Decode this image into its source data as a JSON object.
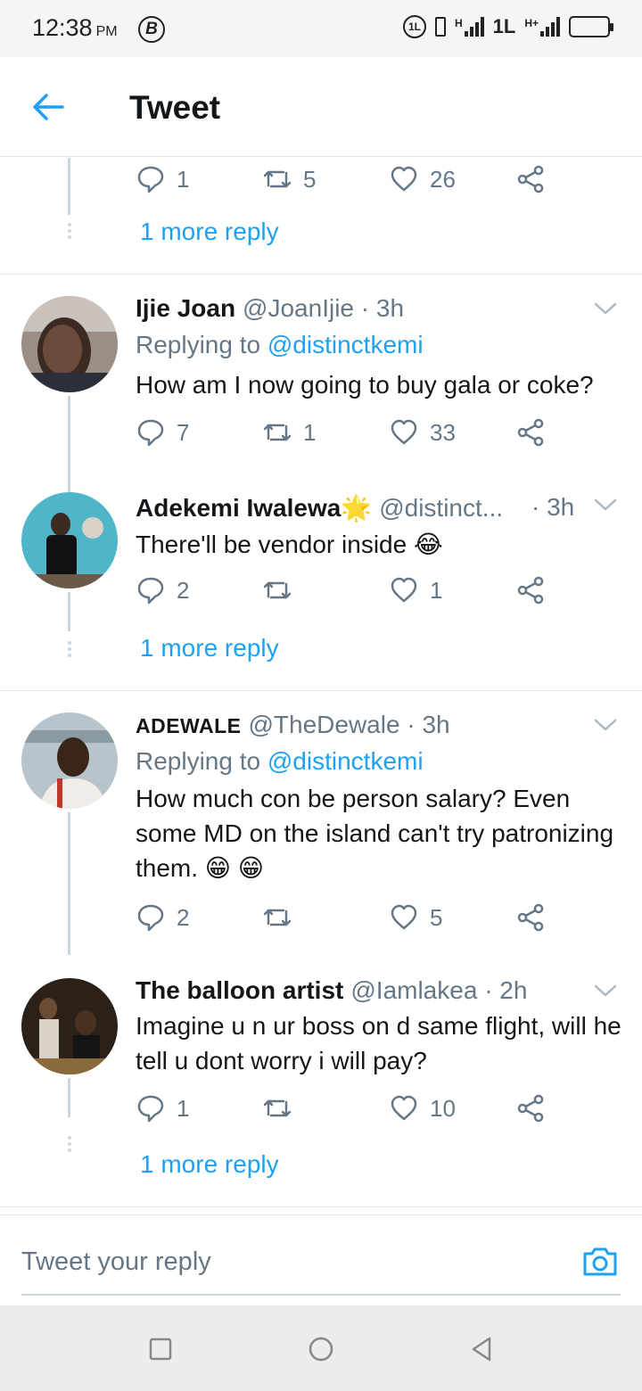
{
  "status_bar": {
    "time": "12:38",
    "ampm": "PM",
    "b_badge": "B",
    "volte": "1L",
    "net1": "H",
    "net2": "1L",
    "net3": "H+"
  },
  "header": {
    "title": "Tweet"
  },
  "top_tweet": {
    "reply_count": "1",
    "retweet_count": "5",
    "like_count": "26",
    "more_reply": "1 more reply"
  },
  "tweets": [
    {
      "name": "Ijie Joan",
      "handle": "@JoanIjie",
      "time": "· 3h",
      "replying_prefix": "Replying to",
      "replying_to": "@distinctkemi",
      "text": "How am I now going to buy gala or coke?",
      "reply_count": "7",
      "retweet_count": "1",
      "like_count": "33"
    },
    {
      "name": "Adekemi Iwalewa",
      "name_emoji": "🌟",
      "handle": "@distinct...",
      "time": "· 3h",
      "text": "There'll be vendor inside 😂",
      "reply_count": "2",
      "retweet_count": "",
      "like_count": "1",
      "more_reply": "1 more reply"
    },
    {
      "name": "ADEWALE",
      "handle": "@TheDewale",
      "time": "· 3h",
      "replying_prefix": "Replying to",
      "replying_to": "@distinctkemi",
      "text": "How much con be person salary? Even some MD on the island can't try patronizing them. 😁 😁",
      "reply_count": "2",
      "retweet_count": "",
      "like_count": "5"
    },
    {
      "name": "The balloon artist",
      "handle": "@Iamlakea",
      "time": "· 2h",
      "text": "Imagine u n ur boss on d same flight, will he tell u dont worry i will pay?",
      "reply_count": "1",
      "retweet_count": "",
      "like_count": "10",
      "more_reply": "1 more reply"
    }
  ],
  "reply_box": {
    "placeholder": "Tweet your reply"
  },
  "colors": {
    "accent": "#1da1f2",
    "text_primary": "#14171a",
    "text_secondary": "#657786",
    "divider": "#e1e8ed"
  },
  "icons": [
    "back-arrow-icon",
    "reply-icon",
    "retweet-icon",
    "like-icon",
    "share-icon",
    "chevron-down-icon",
    "camera-icon",
    "nav-square-icon",
    "nav-circle-icon",
    "nav-triangle-icon"
  ]
}
